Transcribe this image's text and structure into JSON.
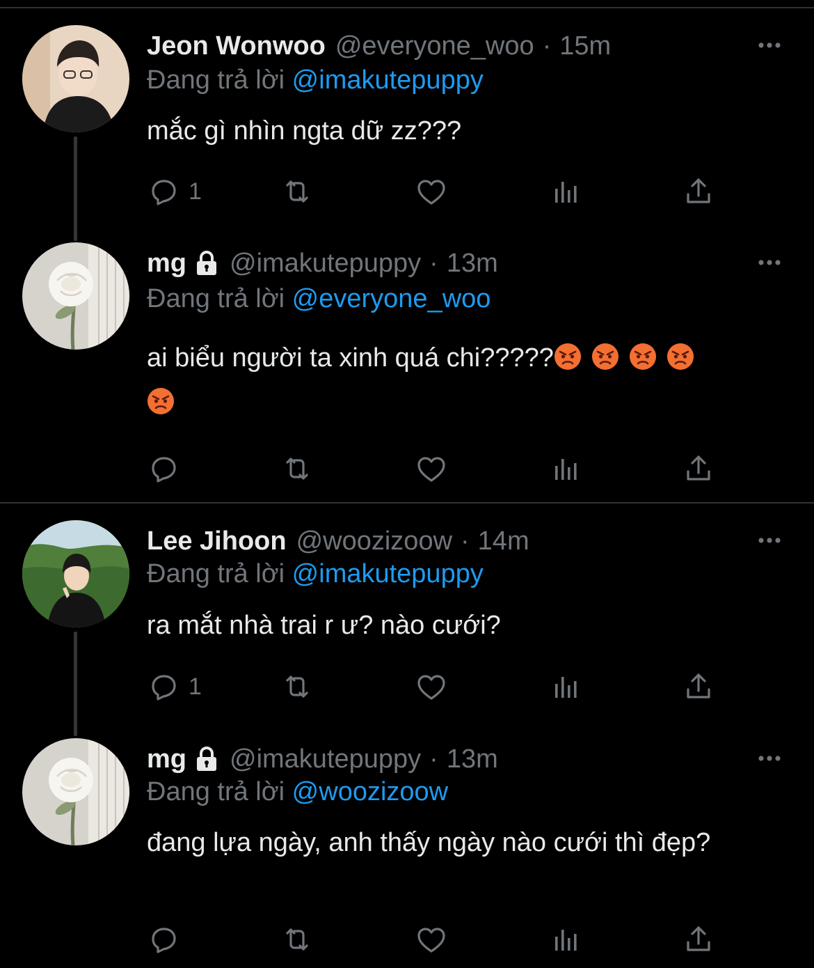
{
  "tweets": [
    {
      "name": "Jeon Wonwoo",
      "handle": "@everyone_woo",
      "dot": "·",
      "time": "15m",
      "replying_prefix": "Đang trả lời",
      "replying_to": "@imakutepuppy",
      "text": "mắc gì nhìn ngta dữ zz???",
      "reply_count": "1",
      "locked": false
    },
    {
      "name": "mg",
      "handle": "@imakutepuppy",
      "dot": "·",
      "time": "13m",
      "replying_prefix": "Đang trả lời",
      "replying_to": "@everyone_woo",
      "text": "ai biểu người ta xinh quá chi?????",
      "emoji": [
        "angry-face",
        "angry-face",
        "angry-face",
        "angry-face",
        "angry-face"
      ],
      "reply_count": "",
      "locked": true
    },
    {
      "name": "Lee Jihoon",
      "handle": "@woozizoow",
      "dot": "·",
      "time": "14m",
      "replying_prefix": "Đang trả lời",
      "replying_to": "@imakutepuppy",
      "text": "ra mắt nhà trai r ư? nào cưới?",
      "reply_count": "1",
      "locked": false
    },
    {
      "name": "mg",
      "handle": "@imakutepuppy",
      "dot": "·",
      "time": "13m",
      "replying_prefix": "Đang trả lời",
      "replying_to": "@woozizoow",
      "text": "đang lựa ngày, anh thấy ngày nào cưới thì đẹp?",
      "reply_count": "",
      "locked": true
    }
  ],
  "icons": [
    "reply-icon",
    "retweet-icon",
    "like-icon",
    "analytics-icon",
    "share-icon",
    "more-icon",
    "lock-icon"
  ],
  "colors": {
    "background": "#000000",
    "text": "#e7e9ea",
    "secondary": "#71767b",
    "accent": "#1d9bf0",
    "divider": "#2f3336"
  }
}
